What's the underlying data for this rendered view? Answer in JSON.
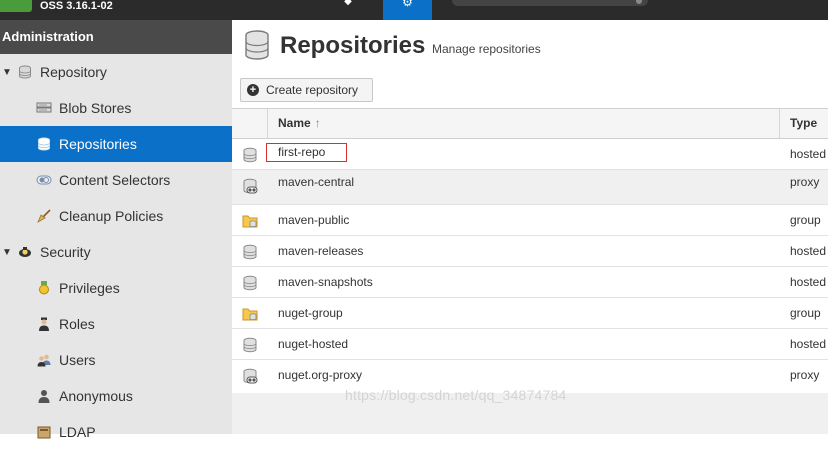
{
  "app": {
    "version": "OSS 3.16.1-02"
  },
  "sidebar": {
    "header": "Administration",
    "groups": [
      {
        "label": "Repository",
        "icon": "database-icon"
      },
      {
        "label": "Security",
        "icon": "security-badge-icon"
      }
    ],
    "items": [
      {
        "label": "Blob Stores",
        "icon": "blob-store-icon"
      },
      {
        "label": "Repositories",
        "icon": "database-icon",
        "active": true
      },
      {
        "label": "Content Selectors",
        "icon": "content-selector-icon"
      },
      {
        "label": "Cleanup Policies",
        "icon": "broom-icon"
      },
      {
        "label": "Privileges",
        "icon": "medal-icon"
      },
      {
        "label": "Roles",
        "icon": "role-user-icon"
      },
      {
        "label": "Users",
        "icon": "users-icon"
      },
      {
        "label": "Anonymous",
        "icon": "anonymous-user-icon"
      },
      {
        "label": "LDAP",
        "icon": "ldap-book-icon"
      }
    ]
  },
  "main": {
    "title": "Repositories",
    "subtitle": "Manage repositories",
    "create_button": "Create repository",
    "columns": {
      "name": "Name",
      "type": "Type",
      "sort_indicator": "↑"
    },
    "rows": [
      {
        "name": "first-repo",
        "type": "hosted",
        "icon": "hosted-db-icon"
      },
      {
        "name": "maven-central",
        "type": "proxy",
        "icon": "proxy-db-icon"
      },
      {
        "name": "maven-public",
        "type": "group",
        "icon": "group-folder-icon"
      },
      {
        "name": "maven-releases",
        "type": "hosted",
        "icon": "hosted-db-icon"
      },
      {
        "name": "maven-snapshots",
        "type": "hosted",
        "icon": "hosted-db-icon"
      },
      {
        "name": "nuget-group",
        "type": "group",
        "icon": "group-folder-icon"
      },
      {
        "name": "nuget-hosted",
        "type": "hosted",
        "icon": "hosted-db-icon"
      },
      {
        "name": "nuget.org-proxy",
        "type": "proxy",
        "icon": "proxy-db-icon"
      }
    ]
  },
  "watermark": "https://blog.csdn.net/qq_34874784",
  "colors": {
    "accent": "#0a70c8",
    "sidebar_bg": "#e6e6e6",
    "admin_header": "#4a4a4a",
    "selected_outline": "#d9302c"
  }
}
